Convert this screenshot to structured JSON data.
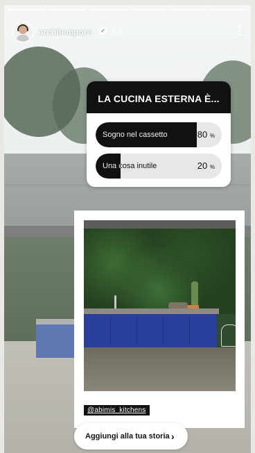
{
  "header": {
    "username": "architempore",
    "time": "2 h",
    "verified_icon": "verified-badge-icon",
    "more_icon": "more-vertical-icon",
    "progress_segments": 6,
    "active_segment": 3
  },
  "poll": {
    "question": "LA CUCINA ESTERNA È...",
    "options": [
      {
        "label": "Sogno nel cassetto",
        "percent_value": "80",
        "percent_sign": "%",
        "fraction": 0.8
      },
      {
        "label": "Una cosa inutile",
        "percent_value": "20",
        "percent_sign": "%",
        "fraction": 0.2
      }
    ]
  },
  "post": {
    "mention": "@abimis_kitchens"
  },
  "actions": {
    "add_to_story": "Aggiungi alla tua storia",
    "chevron": "›"
  },
  "colors": {
    "poll_fill": "#111111",
    "poll_track": "#e7e7e7",
    "cabinet_blue": "#2a3f9b"
  }
}
